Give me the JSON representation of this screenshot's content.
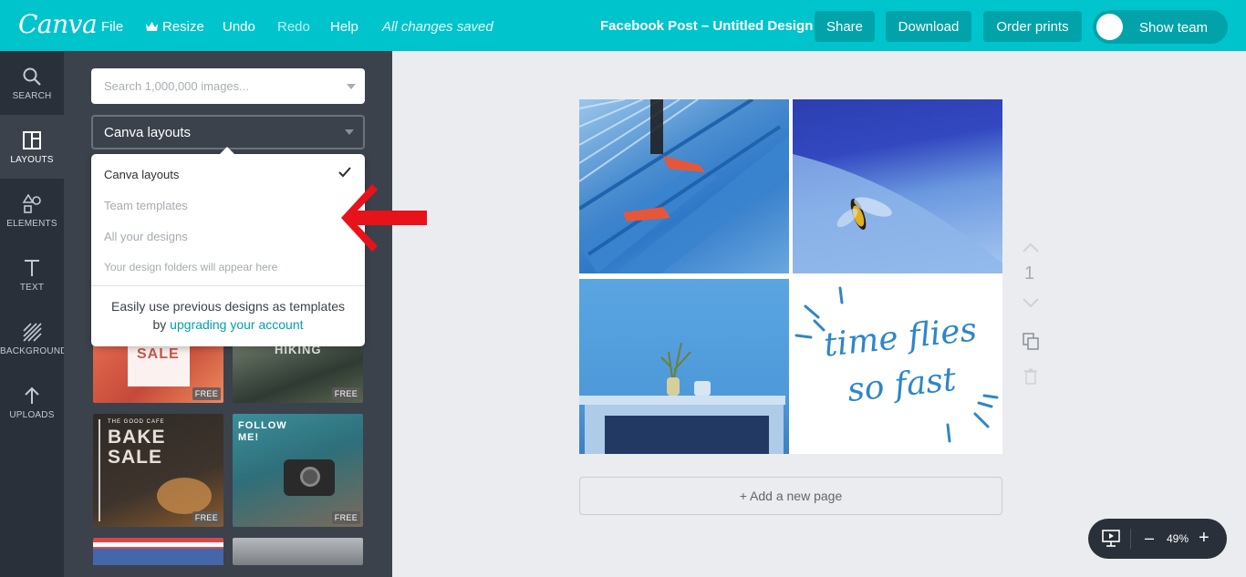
{
  "topbar": {
    "logo": "Canva",
    "menu": {
      "file": "File",
      "resize": "Resize",
      "undo": "Undo",
      "redo": "Redo",
      "help": "Help",
      "status": "All changes saved"
    },
    "title": "Facebook Post – Untitled Design",
    "buttons": {
      "share": "Share",
      "download": "Download",
      "order_prints": "Order prints"
    },
    "show_team": "Show team",
    "brand_color": "#00c4cc"
  },
  "leftnav": {
    "items": [
      {
        "label": "SEARCH",
        "icon": "magnifier-icon"
      },
      {
        "label": "LAYOUTS",
        "icon": "layouts-icon"
      },
      {
        "label": "ELEMENTS",
        "icon": "shapes-icon"
      },
      {
        "label": "TEXT",
        "icon": "text-icon"
      },
      {
        "label": "BACKGROUND",
        "icon": "background-icon"
      },
      {
        "label": "UPLOADS",
        "icon": "upload-arrow-icon"
      }
    ],
    "active": "LAYOUTS"
  },
  "panel": {
    "search": {
      "placeholder": "Search 1,000,000 images..."
    },
    "layout_select": "Canva layouts",
    "dropdown": {
      "items": [
        {
          "label": "Canva layouts",
          "selected": true
        },
        {
          "label": "Team templates",
          "selected": false
        },
        {
          "label": "All your designs",
          "selected": false
        }
      ],
      "hint": "Your design folders will appear here",
      "footer_text": "Easily use previous designs as templates",
      "footer_prefix": "by",
      "footer_link": "upgrading your account"
    },
    "thumbnails": {
      "t1": {
        "text": "SALE",
        "badge": "FREE"
      },
      "t2": {
        "text": "HIKING",
        "badge": "FREE"
      },
      "t3": {
        "text1": "THE GOOD CAFE",
        "text2": "BAKE",
        "text3": "SALE",
        "badge": "FREE"
      },
      "t4": {
        "text1": "FOLLOW",
        "text2": "ME!",
        "badge": "FREE"
      }
    }
  },
  "canvas": {
    "page_number": "1",
    "quote_line1": "time flies",
    "quote_line2": "so fast",
    "add_page": "+ Add a new page"
  },
  "zoom": {
    "minus": "–",
    "value": "49%",
    "plus": "+"
  }
}
